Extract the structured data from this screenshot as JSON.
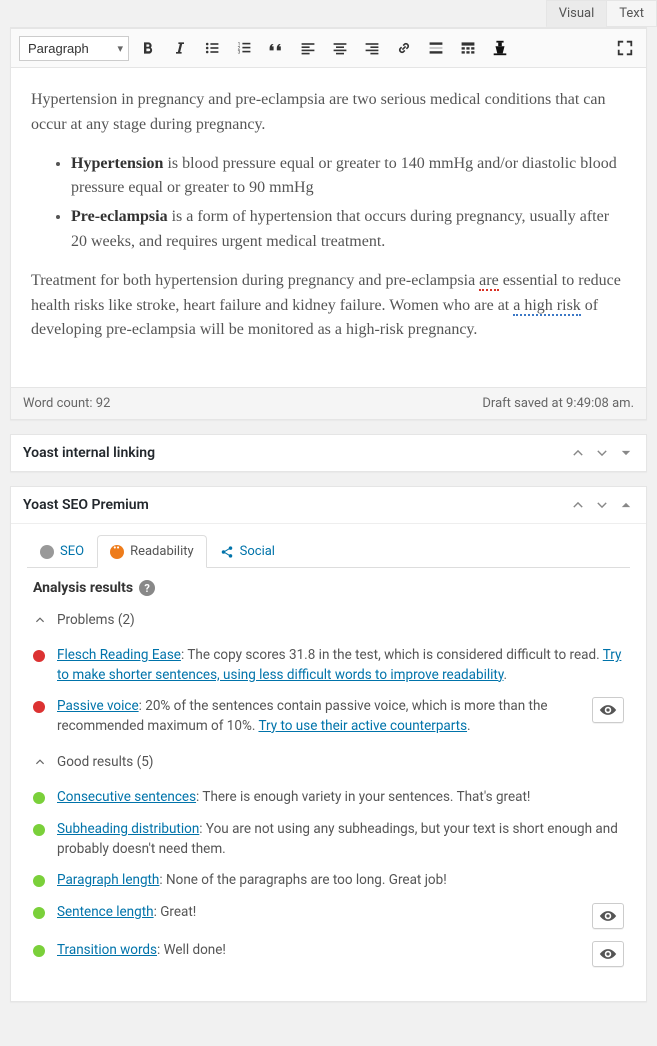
{
  "editor_tabs": {
    "visual": "Visual",
    "text": "Text"
  },
  "toolbar": {
    "format": "Paragraph"
  },
  "content": {
    "p1": "Hypertension in pregnancy and pre-eclampsia are two serious medical conditions that can occur at any stage during pregnancy.",
    "li1_bold": "Hypertension",
    "li1_rest": " is blood pressure equal or greater to 140 mmHg and/or diastolic blood pressure equal or greater to 90 mmHg",
    "li2_bold": "Pre-eclampsia",
    "li2_rest": " is a form of hypertension that occurs during pregnancy, usually after 20 weeks, and requires urgent medical treatment.",
    "p3_a": "Treatment for both hypertension during pregnancy and pre-eclampsia ",
    "p3_are": "are",
    "p3_b": " essential to reduce health risks like stroke, heart failure and kidney failure. Women who are at ",
    "p3_risk": "a high risk",
    "p3_c": " of developing pre-eclampsia will be monitored as a high-risk pregnancy."
  },
  "status": {
    "wordcount_label": "Word count: 92",
    "draft_saved": "Draft saved at 9:49:08 am."
  },
  "panels": {
    "yoast_internal_linking": "Yoast internal linking",
    "yoast_seo_premium": "Yoast SEO Premium"
  },
  "seo_tabs": {
    "seo": "SEO",
    "readability": "Readability",
    "social": "Social"
  },
  "analysis": {
    "title": "Analysis results",
    "problems_label": "Problems (2)",
    "good_label": "Good results (5)",
    "items": {
      "flesch_link": "Flesch Reading Ease",
      "flesch_text": ": The copy scores 31.8 in the test, which is considered difficult to read. ",
      "flesch_fix": "Try to make shorter sentences, using less difficult words to improve readability",
      "passive_link": "Passive voice",
      "passive_text": ": 20% of the sentences contain passive voice, which is more than the recommended maximum of 10%. ",
      "passive_fix": "Try to use their active counterparts",
      "consec_link": "Consecutive sentences",
      "consec_text": ": There is enough variety in your sentences. That's great!",
      "subhead_link": "Subheading distribution",
      "subhead_text": ": You are not using any subheadings, but your text is short enough and probably doesn't need them.",
      "paralen_link": "Paragraph length",
      "paralen_text": ": None of the paragraphs are too long. Great job!",
      "sentlen_link": "Sentence length",
      "sentlen_text": ": Great!",
      "trans_link": "Transition words",
      "trans_text": ": Well done!"
    }
  },
  "colors": {
    "link": "#0073aa",
    "red": "#dc3232",
    "green": "#7ad03a",
    "orange": "#ee7c1b",
    "grey": "#999"
  }
}
